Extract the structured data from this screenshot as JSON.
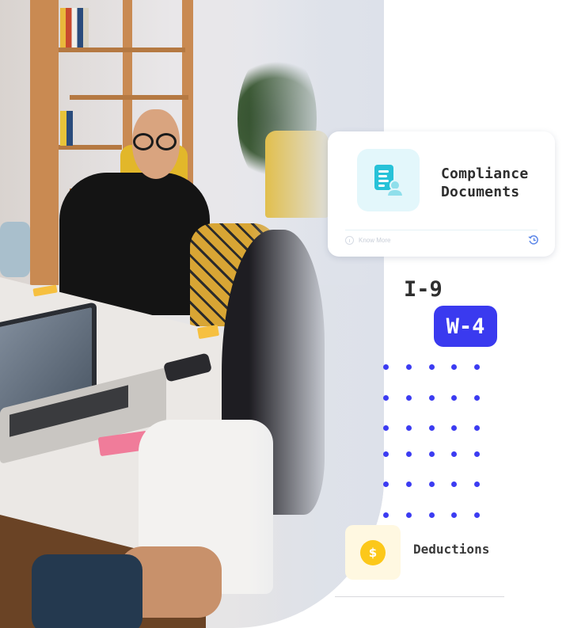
{
  "hero_photo": {
    "description": "Office meeting photo: smiling man in glasses and black sweater at a table, colleagues with laptop and phone in foreground"
  },
  "compliance_card": {
    "icon": "document-user-icon",
    "title_line1": "Compliance",
    "title_line2": "Documents",
    "footer_info_icon": "info-icon",
    "footer_link": "Know More",
    "footer_action_icon": "history-icon",
    "colors": {
      "icon_bg": "#e3f7fb",
      "icon_fg": "#27c2d8"
    }
  },
  "tags": {
    "i9": "I-9",
    "w4": "W-4",
    "w4_color": "#3a3aef"
  },
  "dot_grid": {
    "rows": 6,
    "cols": 5,
    "color": "#3c3cf2"
  },
  "deductions": {
    "icon": "dollar-coin-icon",
    "symbol": "$",
    "label": "Deductions",
    "colors": {
      "box_bg": "#fff8e1",
      "coin": "#fcc81a"
    }
  }
}
